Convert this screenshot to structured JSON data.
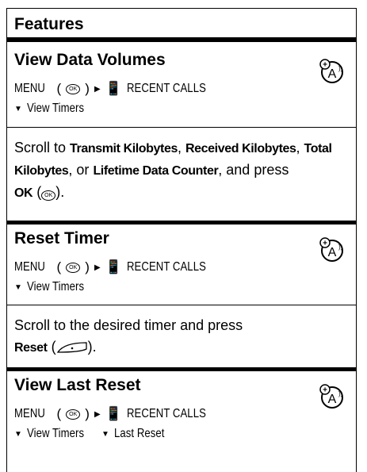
{
  "header": "Features",
  "sections": [
    {
      "title": "View Data Volumes",
      "menu": "MENU",
      "ok_glyph": "OK",
      "recent_calls": "RECENT CALLS",
      "submenu": [
        "View Timers"
      ],
      "para_prefix": "Scroll to ",
      "items": [
        "Transmit Kilobytes",
        "Received Kilobytes",
        "Total Kilobytes",
        "Lifetime Data Counter"
      ],
      "sep1": ", ",
      "sep_or": ", or ",
      "and_press": ", and press",
      "key_label": "OK"
    },
    {
      "title": "Reset Timer",
      "menu": "MENU",
      "ok_glyph": "OK",
      "recent_calls": "RECENT CALLS",
      "submenu": [
        "View Timers"
      ],
      "para_text": "Scroll to the desired timer and press",
      "key_label": "Reset"
    },
    {
      "title": "View Last Reset",
      "menu": "MENU",
      "ok_glyph": "OK",
      "recent_calls": "RECENT CALLS",
      "submenu": [
        "View Timers",
        "Last Reset"
      ]
    }
  ],
  "icon_name": "network-feature-icon"
}
